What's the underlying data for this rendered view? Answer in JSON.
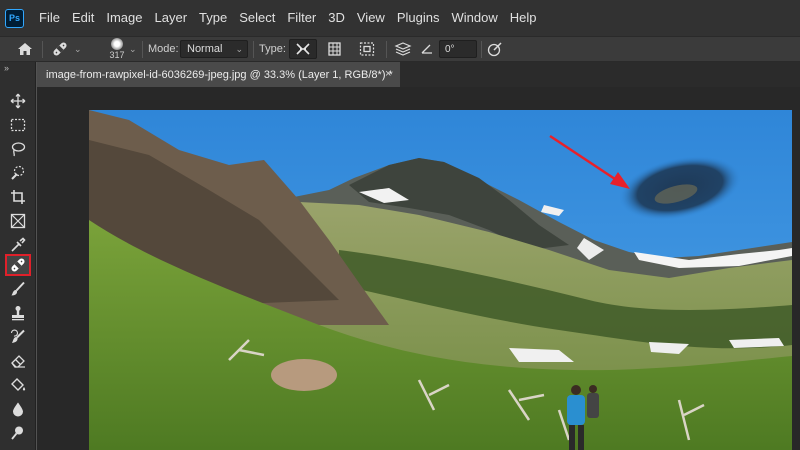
{
  "menubar": {
    "logo": "Ps",
    "items": [
      "File",
      "Edit",
      "Image",
      "Layer",
      "Type",
      "Select",
      "Filter",
      "3D",
      "View",
      "Plugins",
      "Window",
      "Help"
    ]
  },
  "options": {
    "brush_size": "317",
    "mode_label": "Mode:",
    "mode_value": "Normal",
    "type_label": "Type:",
    "angle_value": "0°"
  },
  "document": {
    "tab_title": "image-from-rawpixel-id-6036269-jpeg.jpg @ 33.3% (Layer 1, RGB/8*) *",
    "close_glyph": "×"
  },
  "toolbar": {
    "collapse_glyph": "››",
    "tools": [
      "move",
      "rectangular-marquee",
      "lasso",
      "quick-selection",
      "crop",
      "frame",
      "eyedropper",
      "spot-healing-brush",
      "brush",
      "clone-stamp",
      "history-brush",
      "eraser",
      "paint-bucket",
      "blur",
      "dodge"
    ],
    "selected_tool": "spot-healing-brush"
  },
  "colors": {
    "menubar_bg": "#323232",
    "optionsbar_bg": "#3b3b3b",
    "toolbar_bg": "#2f2f2f",
    "canvas_bg": "#282828",
    "selected_highlight": "#e0202a",
    "annotation_arrow": "#e8202a",
    "sky": "#3a8fdc"
  }
}
